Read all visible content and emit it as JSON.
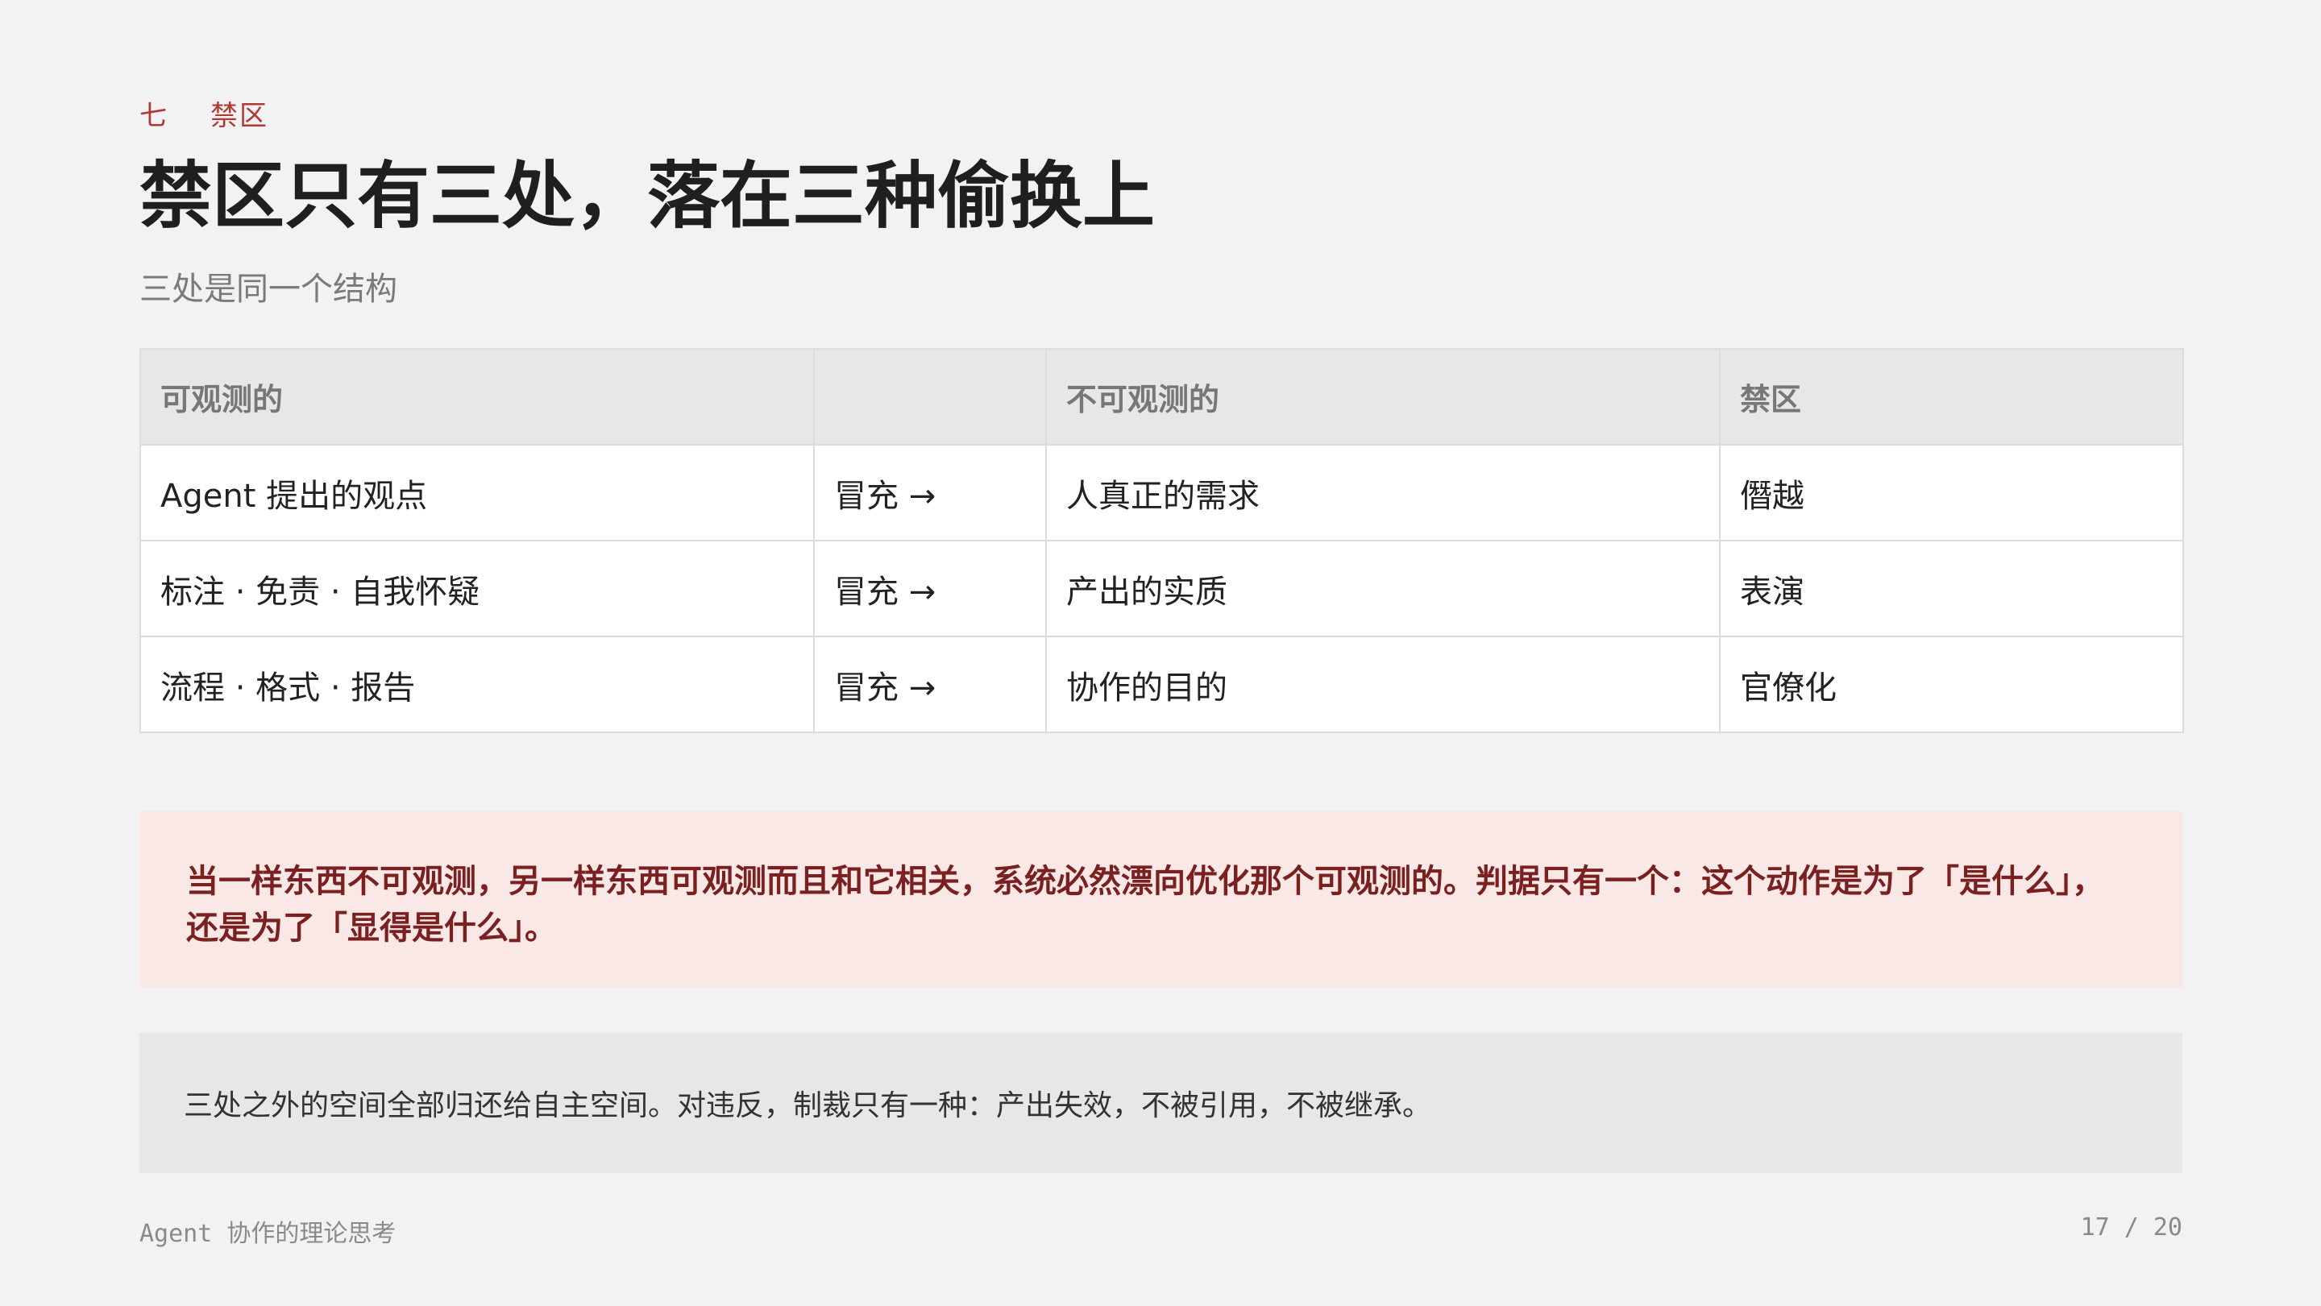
{
  "header": {
    "section_number": "七",
    "section_name": "禁区",
    "title": "禁区只有三处，落在三种偷换上",
    "subtitle": "三处是同一个结构"
  },
  "table": {
    "headers": [
      "可观测的",
      "",
      "不可观测的",
      "禁区"
    ],
    "rows": [
      [
        "Agent  提出的观点",
        "冒充 →",
        "人真正的需求",
        "僭越"
      ],
      [
        "标注 · 免责 · 自我怀疑",
        "冒充 →",
        "产出的实质",
        "表演"
      ],
      [
        "流程 · 格式 · 报告",
        "冒充 →",
        "协作的目的",
        "官僚化"
      ]
    ]
  },
  "callout": {
    "text": "当一样东西不可观测，另一样东西可观测而且和它相关，系统必然漂向优化那个可观测的。判据只有一个：这个动作是为了「是什么」，还是为了「显得是什么」。"
  },
  "note": {
    "text": "三处之外的空间全部归还给自主空间。对违反，制裁只有一种：产出失效，不被引用，不被继承。"
  },
  "footer": {
    "left": "Agent  协作的理论思考",
    "right": "17 / 20"
  },
  "colors": {
    "accent": "#b03a32",
    "callout_bg": "#f9e8e6",
    "callout_text": "#7a2020",
    "page_bg": "#f2f2f4"
  }
}
